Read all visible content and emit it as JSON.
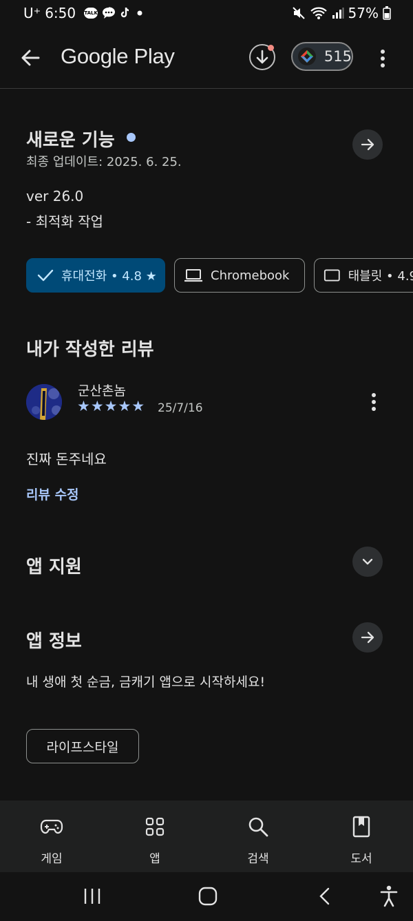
{
  "status_bar": {
    "carrier": "U⁺",
    "time": "6:50",
    "battery": "57%",
    "icons": [
      "kakaotalk-icon",
      "message-icon",
      "tiktok-icon",
      "dot-icon",
      "mute-icon",
      "wifi-icon",
      "signal-icon",
      "battery-icon"
    ]
  },
  "app_bar": {
    "title": "Google Play",
    "points": "515"
  },
  "whats_new": {
    "title": "새로운 기능",
    "updated": "최종 업데이트: 2025. 6. 25.",
    "version": "ver 26.0",
    "note": "- 최적화 작업"
  },
  "device_chips": [
    {
      "label": "휴대전화 • 4.8 ★",
      "selected": true
    },
    {
      "label": "Chromebook",
      "selected": false
    },
    {
      "label": "태블릿 • 4.9",
      "selected": false
    }
  ],
  "my_review": {
    "heading": "내가 작성한 리뷰",
    "author": "군산촌놈",
    "rating": 5,
    "stars": "★★★★★",
    "date": "25/7/16",
    "text": "진짜 돈주네요",
    "edit_link": "리뷰 수정"
  },
  "app_support": {
    "title": "앱 지원"
  },
  "app_info": {
    "title": "앱 정보",
    "description": "내 생애 첫 순금, 금캐기 앱으로 시작하세요!",
    "category": "라이프스타일"
  },
  "bottom_nav": [
    {
      "label": "게임",
      "icon": "gamepad-icon"
    },
    {
      "label": "앱",
      "icon": "apps-grid-icon"
    },
    {
      "label": "검색",
      "icon": "search-icon"
    },
    {
      "label": "도서",
      "icon": "book-icon"
    }
  ],
  "colors": {
    "background": "#131313",
    "accent_chip": "#004a77",
    "link": "#a8c7fa",
    "star": "#a8c7fa"
  }
}
